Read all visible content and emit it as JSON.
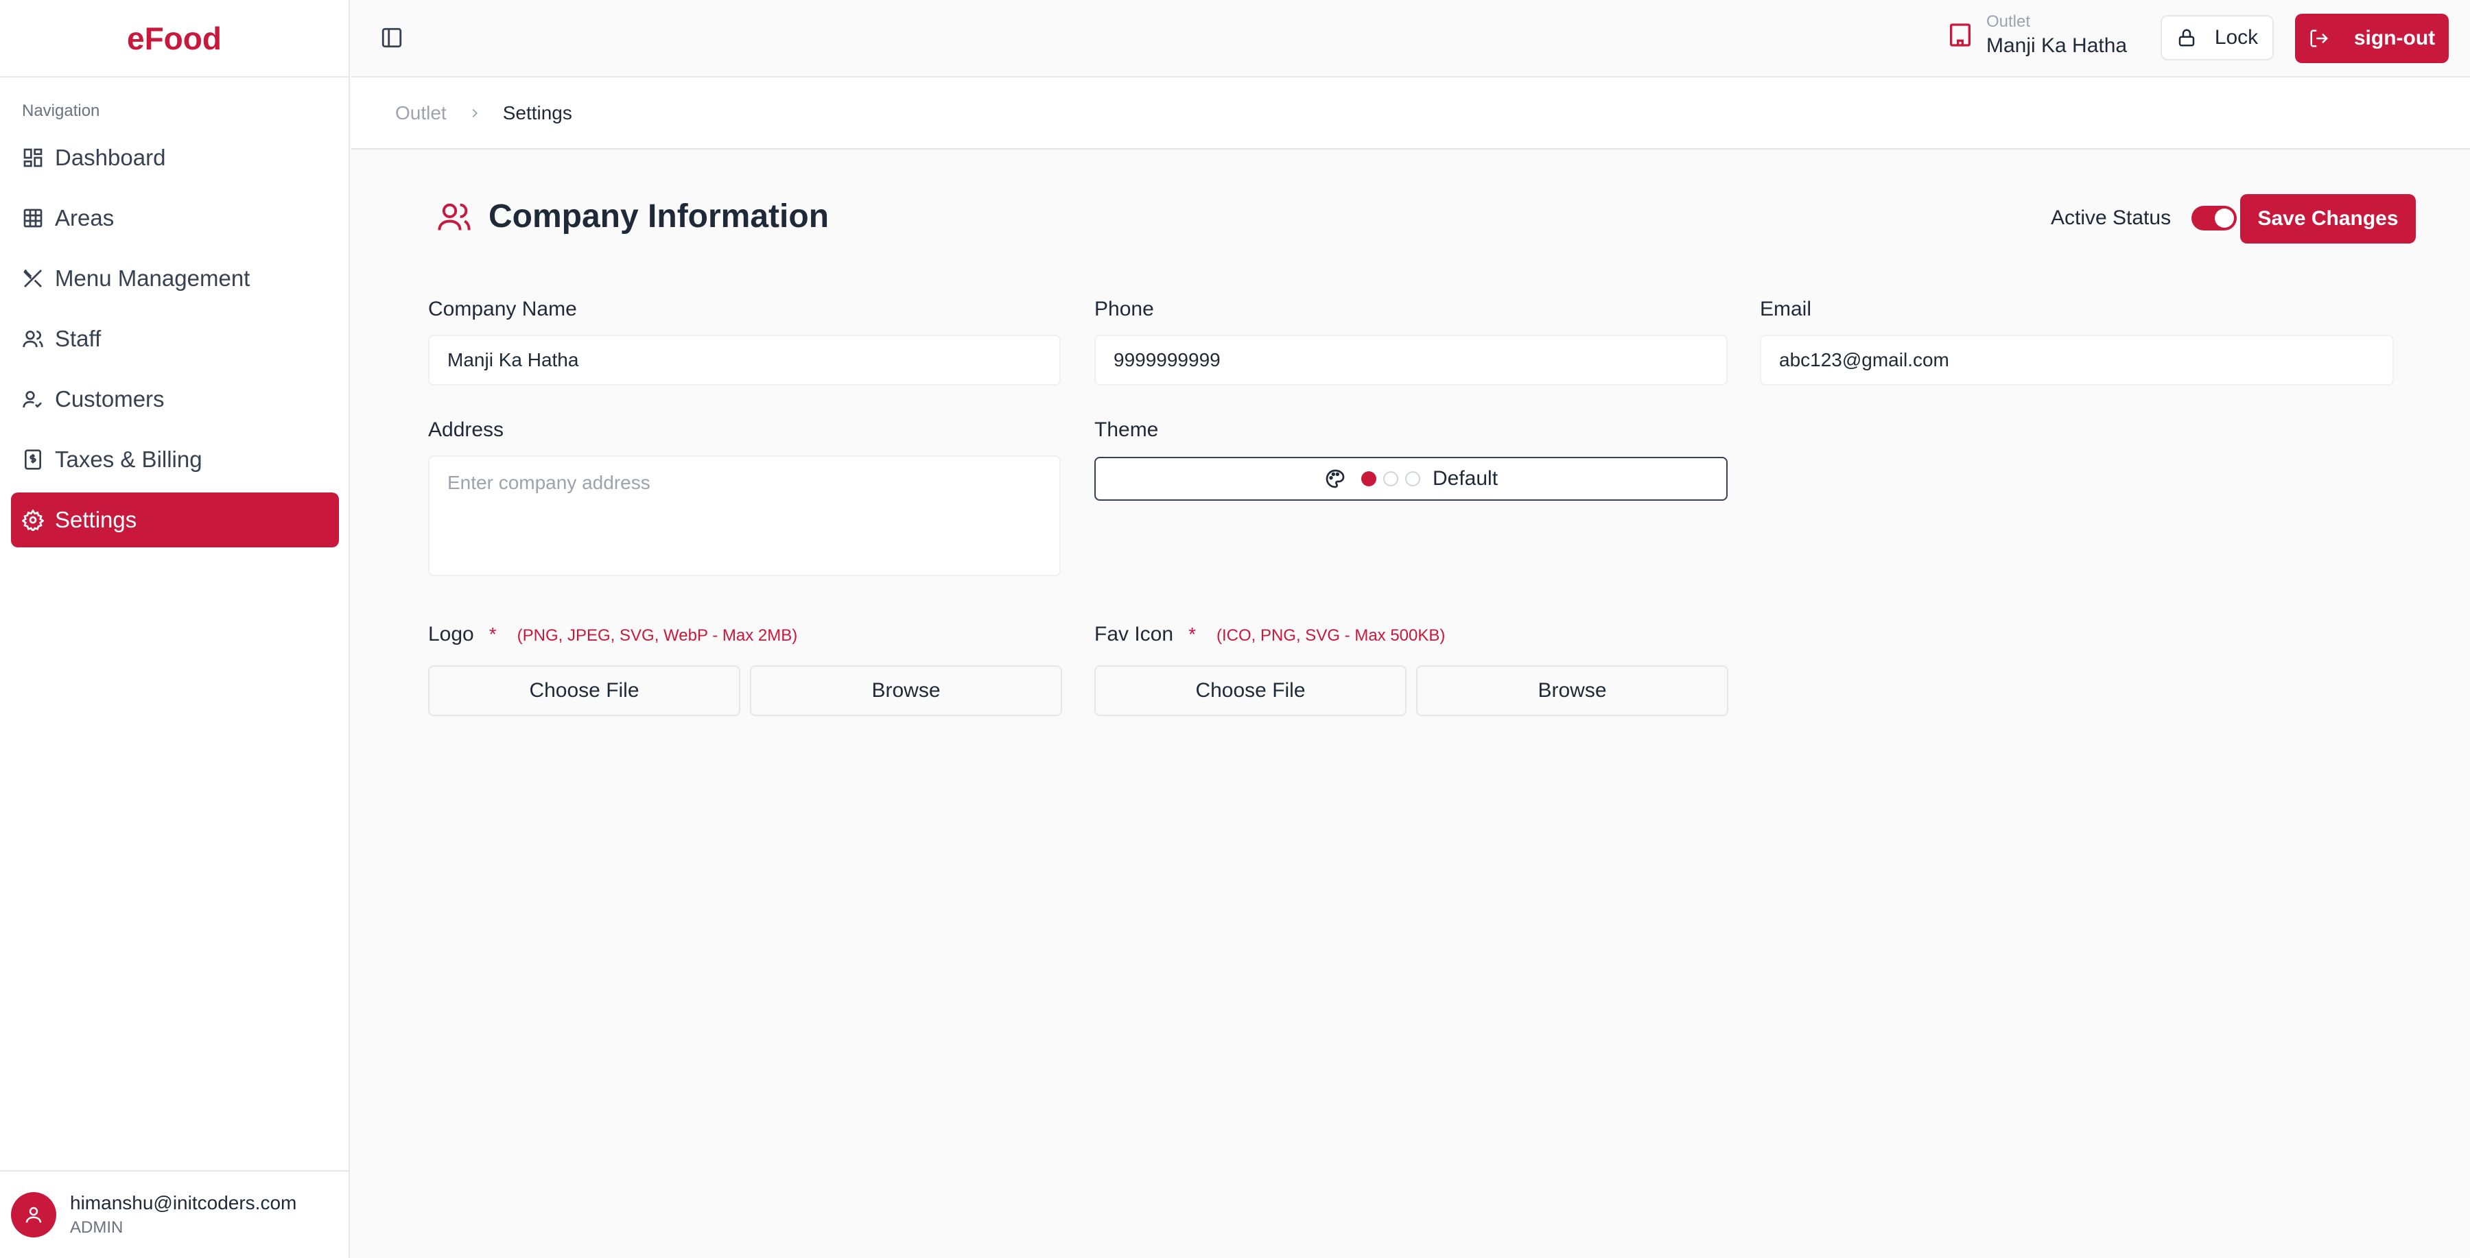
{
  "app": {
    "brand": "eFood"
  },
  "sidebar": {
    "heading": "Navigation",
    "items": [
      {
        "label": "Dashboard",
        "icon": "dashboard-icon"
      },
      {
        "label": "Areas",
        "icon": "grid-icon"
      },
      {
        "label": "Menu Management",
        "icon": "utensils-icon"
      },
      {
        "label": "Staff",
        "icon": "users-icon"
      },
      {
        "label": "Customers",
        "icon": "user-check-icon"
      },
      {
        "label": "Taxes & Billing",
        "icon": "receipt-icon"
      },
      {
        "label": "Settings",
        "icon": "gear-icon",
        "active": true
      }
    ],
    "user": {
      "email": "himanshu@initcoders.com",
      "role": "ADMIN"
    }
  },
  "topbar": {
    "outlet_label": "Outlet",
    "outlet_name": "Manji Ka Hatha",
    "lock_label": "Lock",
    "signout_label": "sign-out"
  },
  "breadcrumb": {
    "parent": "Outlet",
    "current": "Settings"
  },
  "page": {
    "title": "Company Information",
    "active_status_label": "Active Status",
    "active_status": true,
    "save_label": "Save Changes"
  },
  "form": {
    "company_name": {
      "label": "Company Name",
      "value": "Manji Ka Hatha"
    },
    "phone": {
      "label": "Phone",
      "value": "9999999999"
    },
    "email": {
      "label": "Email",
      "value": "abc123@gmail.com"
    },
    "address": {
      "label": "Address",
      "placeholder": "Enter company address",
      "value": ""
    },
    "theme": {
      "label": "Theme",
      "value": "Default"
    },
    "logo": {
      "label": "Logo",
      "required_mark": "*",
      "hint": "(PNG, JPEG, SVG, WebP - Max 2MB)",
      "choose_label": "Choose File",
      "browse_label": "Browse"
    },
    "favicon": {
      "label": "Fav Icon",
      "required_mark": "*",
      "hint": "(ICO, PNG, SVG - Max 500KB)",
      "choose_label": "Choose File",
      "browse_label": "Browse"
    }
  },
  "colors": {
    "accent": "#c8193c",
    "text": "#1f2937",
    "muted": "#9ca3af",
    "border": "#e5e7eb"
  }
}
